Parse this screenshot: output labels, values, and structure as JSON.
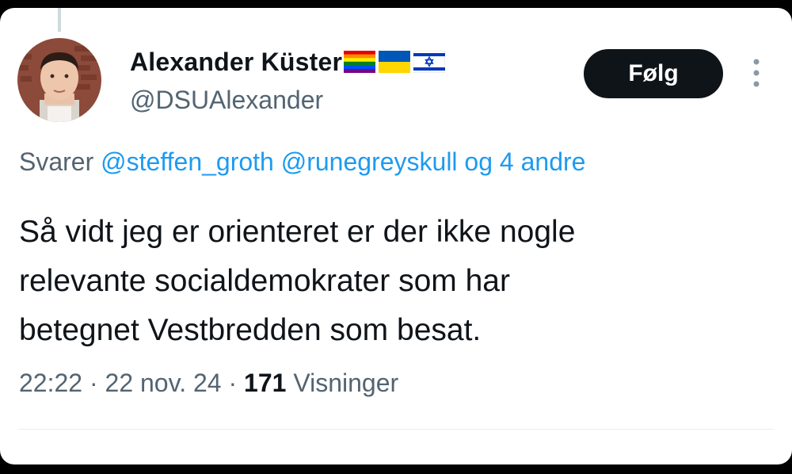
{
  "tweet": {
    "author": {
      "display_name": "Alexander Küster",
      "handle": "@DSUAlexander",
      "flags": [
        "rainbow-flag-icon",
        "ukraine-flag-icon",
        "israel-flag-icon"
      ]
    },
    "follow_label": "Følg",
    "reply_context": {
      "prefix": "Svarer",
      "mention_1": "@steffen_groth",
      "mention_2": "@runegreyskull",
      "others": "og 4 andre"
    },
    "text_lines": [
      "Så vidt jeg er orienteret er der ikke nogle",
      "relevante socialdemokrater som har",
      "betegnet Vestbredden som besat."
    ],
    "meta": {
      "time": "22:22",
      "separator": "·",
      "date": "22 nov. 24",
      "views_count": "171",
      "views_label": "Visninger"
    }
  },
  "colors": {
    "text_primary": "#0f1419",
    "text_secondary": "#536471",
    "link": "#1d9bf0",
    "button_bg": "#0f1419"
  }
}
